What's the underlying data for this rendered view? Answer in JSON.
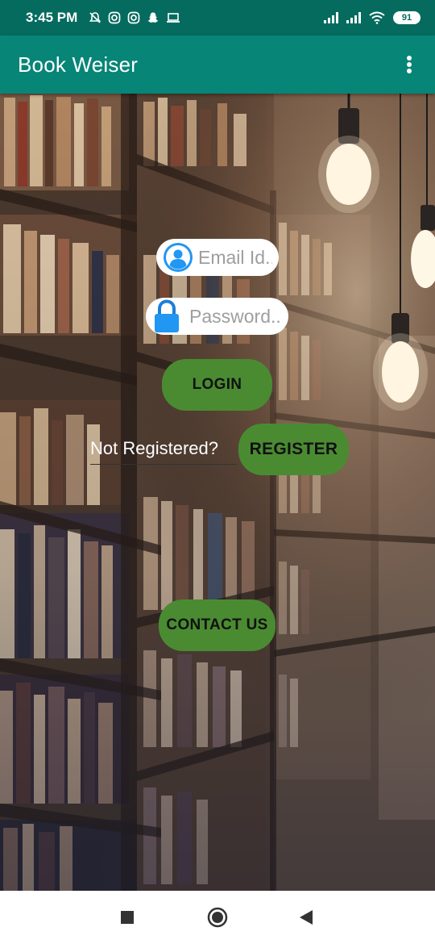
{
  "status_bar": {
    "time": "3:45 PM",
    "battery": "91",
    "left_icons": [
      "bell-off-icon",
      "instagram-icon",
      "instagram-icon",
      "snapchat-icon",
      "laptop-icon"
    ],
    "right_icons": [
      "signal-icon",
      "signal-icon",
      "wifi-icon",
      "battery-icon"
    ]
  },
  "app_bar": {
    "title": "Book Weiser",
    "menu_icon": "overflow-menu-icon"
  },
  "login_form": {
    "email_placeholder": "Email Id..",
    "email_icon": "user-avatar-icon",
    "password_placeholder": "Password..",
    "password_icon": "lock-icon",
    "login_label": "LOGIN",
    "not_registered_text": "Not Registered?",
    "register_label": "REGISTER",
    "contact_label": "CONTACT US"
  },
  "nav_bar": {
    "icons": [
      "recents-square-icon",
      "home-circle-icon",
      "back-triangle-icon"
    ]
  },
  "colors": {
    "status_bar": "#056b5f",
    "app_bar": "#078577",
    "button": "#4a8b32",
    "avatar_blue": "#2196f3"
  }
}
